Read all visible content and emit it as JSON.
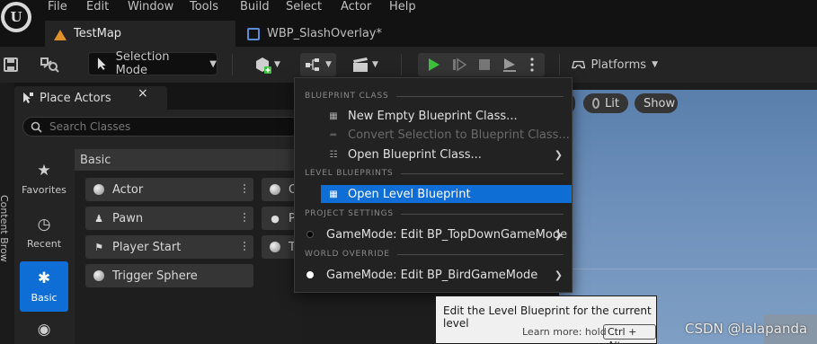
{
  "menubar": {
    "items": [
      "File",
      "Edit",
      "Window",
      "Tools",
      "Build",
      "Select",
      "Actor",
      "Help"
    ]
  },
  "tabs": [
    {
      "label": "TestMap",
      "active": true
    },
    {
      "label": "WBP_SlashOverlay*",
      "active": false
    }
  ],
  "toolbar": {
    "selection_mode": "Selection Mode",
    "platforms": "Platforms"
  },
  "left_strip": {
    "content_browser": "Content Brow"
  },
  "place_actors": {
    "title": "Place Actors",
    "close": "×",
    "search_placeholder": "Search Classes",
    "categories": [
      {
        "label": "Favorites",
        "icon": "star-icon"
      },
      {
        "label": "Recent",
        "icon": "clock-icon"
      },
      {
        "label": "Basic",
        "icon": "shapes-icon",
        "selected": true
      }
    ],
    "section_header": "Basic",
    "items": [
      {
        "label": "Actor",
        "icon": "sphere-icon"
      },
      {
        "label": "Pawn",
        "icon": "pawn-icon"
      },
      {
        "label": "Player Start",
        "icon": "flag-icon"
      },
      {
        "label": "Trigger Sphere",
        "icon": "sphere-icon"
      }
    ],
    "partial_items": [
      "C",
      "P",
      "T"
    ]
  },
  "viewport": {
    "lit": "Lit",
    "show": "Show"
  },
  "blueprint_menu": {
    "sections": [
      {
        "header": "BLUEPRINT CLASS",
        "items": [
          {
            "label": "New Empty Blueprint Class...",
            "enabled": true
          },
          {
            "label": "Convert Selection to Blueprint Class...",
            "enabled": false
          },
          {
            "label": "Open Blueprint Class...",
            "enabled": true,
            "submenu": true
          }
        ]
      },
      {
        "header": "LEVEL BLUEPRINTS",
        "items": [
          {
            "label": "Open Level Blueprint",
            "enabled": true,
            "highlighted": true
          }
        ]
      },
      {
        "header": "PROJECT SETTINGS",
        "items": [
          {
            "label": "GameMode: Edit BP_TopDownGameMode",
            "enabled": true,
            "submenu": true,
            "bullet": "#000000"
          }
        ]
      },
      {
        "header": "WORLD OVERRIDE",
        "items": [
          {
            "label": "GameMode: Edit BP_BirdGameMode",
            "enabled": true,
            "submenu": true,
            "bullet": "#ffffff"
          }
        ]
      }
    ]
  },
  "tooltip": {
    "text": "Edit the Level Blueprint for the current level",
    "learn_more": "Learn more: hold",
    "shortcut": "Ctrl + Alt"
  },
  "watermark": "CSDN @lalapanda",
  "colors": {
    "accent": "#0e6ed6",
    "play_green": "#3fbf3f",
    "map_tab_icon": "#e0922a"
  }
}
